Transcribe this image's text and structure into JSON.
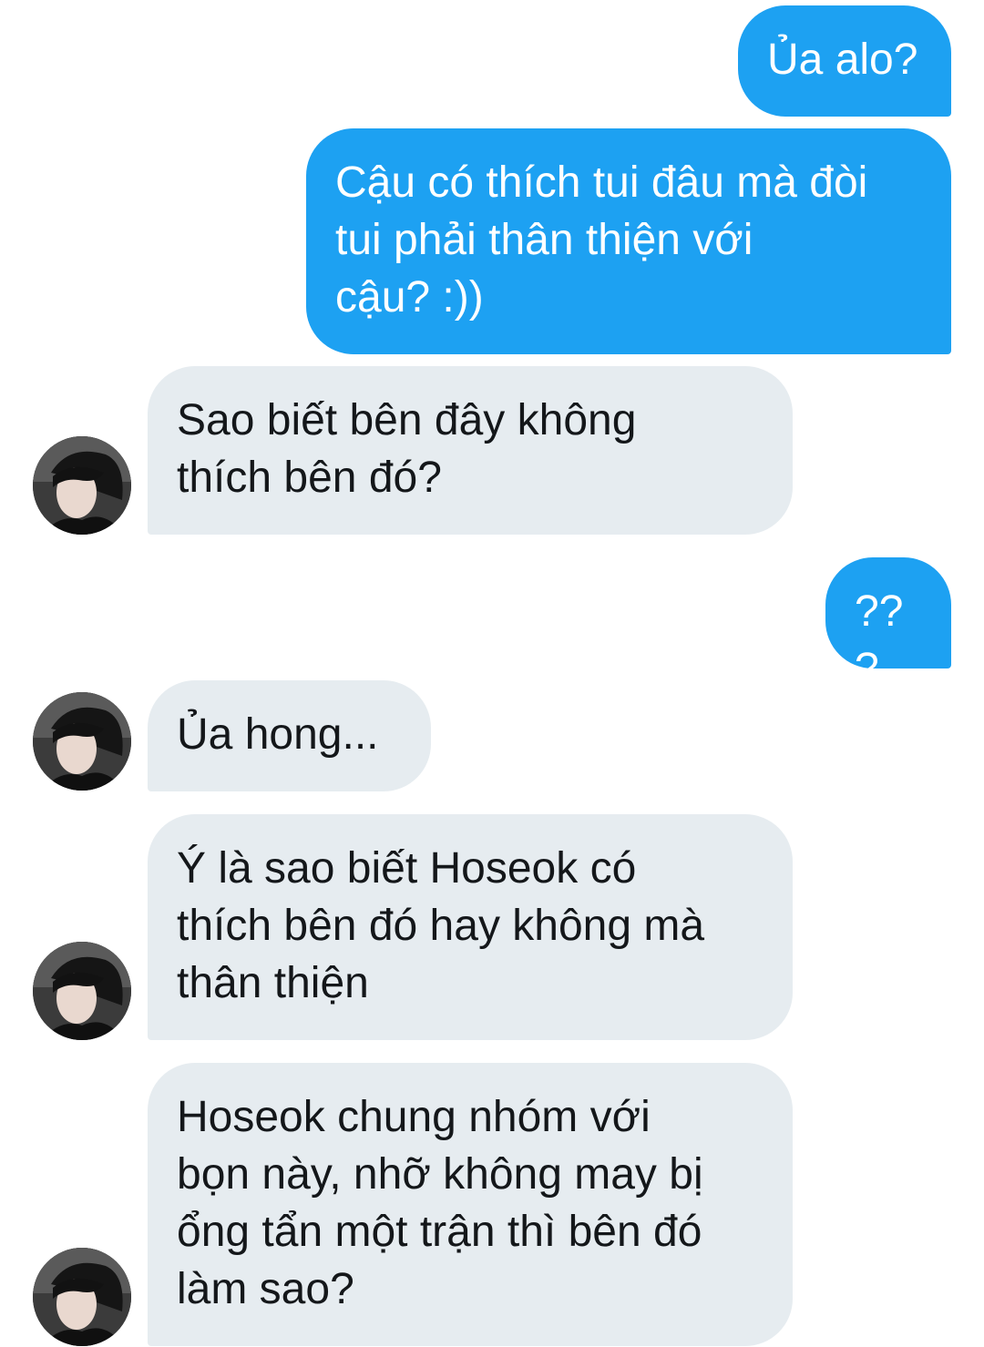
{
  "messages": [
    {
      "id": "m1",
      "direction": "sent",
      "text": "Ủa alo?"
    },
    {
      "id": "m2",
      "direction": "sent",
      "text": "Cậu có thích tui đâu mà đòi\ntui phải thân thiện với\ncậu? :))"
    },
    {
      "id": "m3",
      "direction": "received",
      "text": "Sao biết bên đây không\nthích bên đó?"
    },
    {
      "id": "m4",
      "direction": "sent",
      "text": "???"
    },
    {
      "id": "m5",
      "direction": "received",
      "text": "Ủa hong..."
    },
    {
      "id": "m6",
      "direction": "received",
      "text": "Ý là sao biết Hoseok có\nthích bên đó hay không mà\nthân thiện"
    },
    {
      "id": "m7",
      "direction": "received",
      "text": "Hoseok chung nhóm với\nbọn này, nhỡ không may bị\nổng tẩn một trận thì bên đó\nlàm sao?"
    }
  ],
  "colors": {
    "sent_bubble": "#1da1f2",
    "sent_text": "#ffffff",
    "received_bubble": "#e6ecf0",
    "received_text": "#14171a"
  },
  "icons": {
    "avatar": "contact-avatar-photo"
  }
}
